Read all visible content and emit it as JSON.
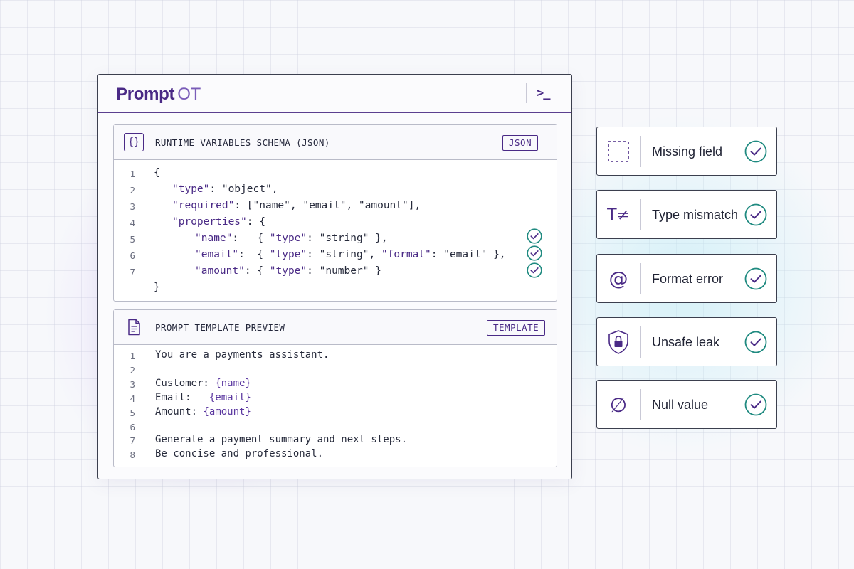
{
  "app": {
    "brand_primary": "Prompt",
    "brand_secondary": "OT",
    "terminal_glyph": ">_"
  },
  "schema_panel": {
    "icon_glyph": "{}",
    "title": "RUNTIME VARIABLES SCHEMA (JSON)",
    "badge": "JSON",
    "line_numbers": [
      "1",
      "2",
      "3",
      "4",
      "5",
      "6",
      "7"
    ],
    "lines": {
      "l1": "{",
      "l2_key": "\"type\"",
      "l2_rest": ": \"object\",",
      "l3_key": "\"required\"",
      "l3_rest": ": [\"name\", \"email\", \"amount\"],",
      "l4_key": "\"properties\"",
      "l4_rest": ": {",
      "l5_key": "\"name\"",
      "l5_mid": ":   { ",
      "l5_key2": "\"type\"",
      "l5_rest": ": \"string\" },",
      "l6_key": "\"email\"",
      "l6_mid": ":  { ",
      "l6_key2": "\"type\"",
      "l6_mid2": ": \"string\", ",
      "l6_key3": "\"format\"",
      "l6_rest": ": \"email\" },",
      "l7_key": "\"amount\"",
      "l7_mid": ": { ",
      "l7_key2": "\"type\"",
      "l7_rest": ": \"number\" }",
      "l8": "}"
    }
  },
  "template_panel": {
    "title": "PROMPT TEMPLATE PREVIEW",
    "badge": "TEMPLATE",
    "line_numbers": [
      "1",
      "2",
      "3",
      "4",
      "5",
      "6",
      "7",
      "8"
    ],
    "lines": {
      "l1": "You are a payments assistant.",
      "l3_label": "Customer: ",
      "l3_var": "{name}",
      "l4_label": "Email:   ",
      "l4_var": "{email}",
      "l5_label": "Amount: ",
      "l5_var": "{amount}",
      "l7": "Generate a payment summary and next steps.",
      "l8": "Be concise and professional."
    }
  },
  "checks": [
    {
      "label": "Missing field",
      "icon": "dashed-square-icon"
    },
    {
      "label": "Type mismatch",
      "icon": "type-not-equal-icon",
      "glyph": "T≠"
    },
    {
      "label": "Format error",
      "icon": "at-sign-icon",
      "glyph": "@"
    },
    {
      "label": "Unsafe leak",
      "icon": "shield-lock-icon"
    },
    {
      "label": "Null value",
      "icon": "null-set-icon",
      "glyph": "∅"
    }
  ],
  "colors": {
    "brand": "#4a2a86",
    "check": "#1f8a80"
  }
}
